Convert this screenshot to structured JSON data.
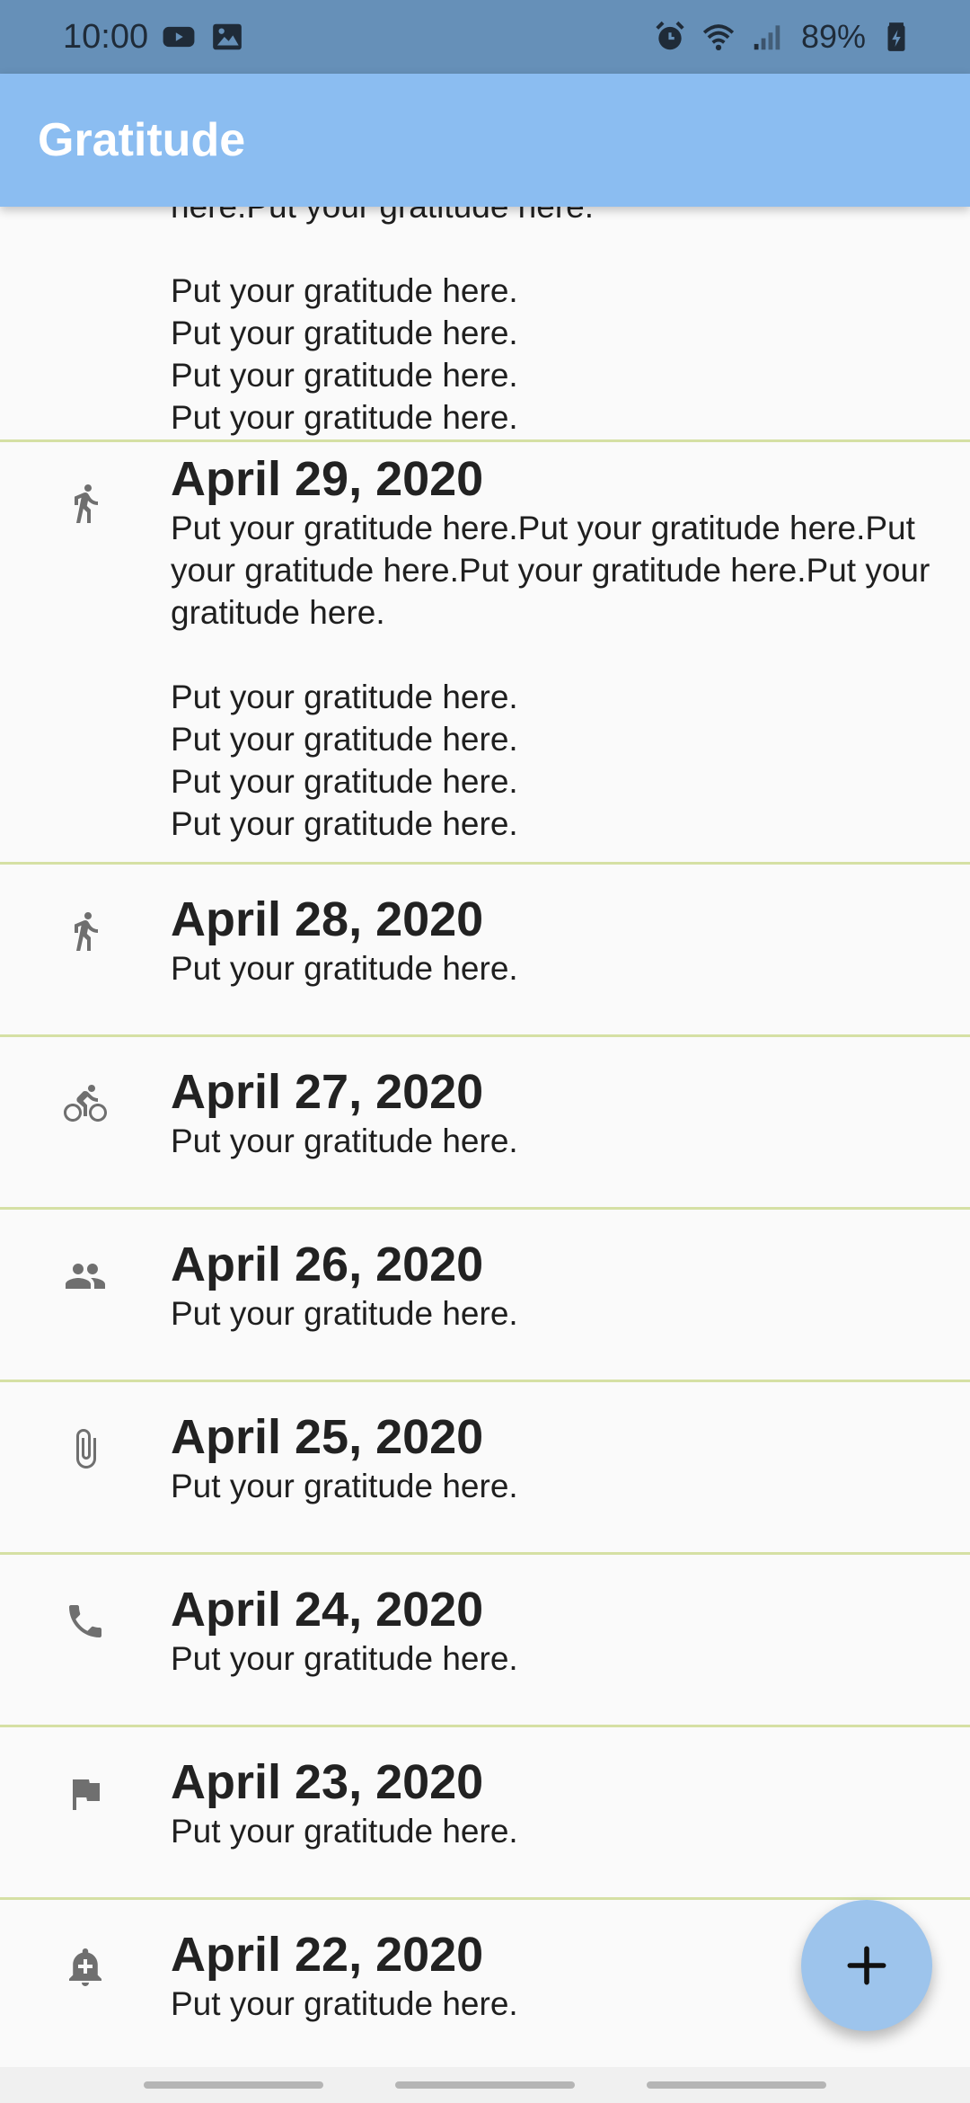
{
  "status_bar": {
    "time": "10:00",
    "battery_percent": "89%",
    "left_icons": [
      "youtube-icon",
      "image-icon"
    ],
    "right_icons": [
      "alarm-icon",
      "wifi-icon",
      "signal-icon",
      "battery-charging-icon"
    ]
  },
  "app_bar": {
    "title": "Gratitude"
  },
  "entries": [
    {
      "date": "",
      "icon": "",
      "text": "here.Put your gratitude here.\n\nPut your gratitude here.\nPut your gratitude here.\nPut your gratitude here.\nPut your gratitude here."
    },
    {
      "date": "April 29, 2020",
      "icon": "walk-icon",
      "text": "Put your gratitude here.Put your gratitude here.Put your gratitude here.Put your gratitude here.Put your gratitude here.\n\nPut your gratitude here.\nPut your gratitude here.\nPut your gratitude here.\nPut your gratitude here."
    },
    {
      "date": "April 28, 2020",
      "icon": "walk-icon",
      "text": "Put your gratitude here."
    },
    {
      "date": "April 27, 2020",
      "icon": "bike-icon",
      "text": "Put your gratitude here."
    },
    {
      "date": "April 26, 2020",
      "icon": "people-icon",
      "text": "Put your gratitude here."
    },
    {
      "date": "April 25, 2020",
      "icon": "paperclip-icon",
      "text": "Put your gratitude here."
    },
    {
      "date": "April 24, 2020",
      "icon": "phone-icon",
      "text": "Put your gratitude here."
    },
    {
      "date": "April 23, 2020",
      "icon": "flag-icon",
      "text": "Put your gratitude here."
    },
    {
      "date": "April 22, 2020",
      "icon": "bell-plus-icon",
      "text": "Put your gratitude here."
    }
  ],
  "fab": {
    "icon": "plus-icon"
  },
  "colors": {
    "status_bar": "#6690b8",
    "app_bar": "#8bbdf1",
    "fab": "#9dc4ec",
    "divider": "#d5e0a4",
    "icon": "#6f6f6f"
  }
}
